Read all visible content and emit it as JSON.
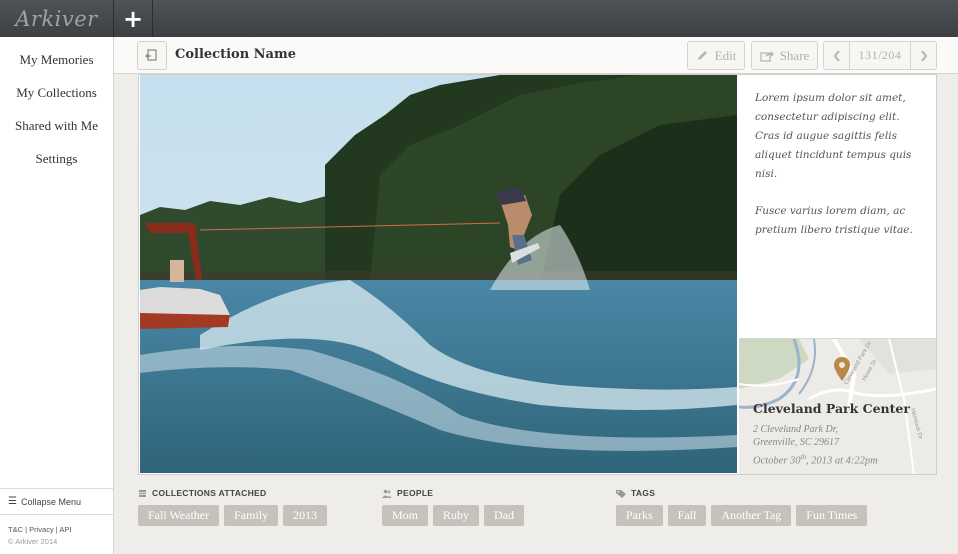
{
  "app": {
    "logo": "Arkiver",
    "add_label": "+"
  },
  "sidebar": {
    "items": [
      {
        "label": "My Memories"
      },
      {
        "label": "My Collections"
      },
      {
        "label": "Shared with Me"
      },
      {
        "label": "Settings"
      }
    ],
    "collapse_label": "Collapse Menu",
    "footer_links": [
      "T&C",
      "Privacy",
      "API"
    ],
    "footer_separator": " | ",
    "copyright": "© Arkiver 2014"
  },
  "header": {
    "collection_name": "Collection Name",
    "edit_label": "Edit",
    "share_label": "Share",
    "pager_text": "131/204"
  },
  "memory": {
    "description": [
      "Lorem ipsum dolor sit amet, consectetur adipiscing elit. Cras id augue sagittis felis aliquet tincidunt tempus quis nisi.",
      "Fusce varius lorem diam, ac pretium libero tristique vitae."
    ],
    "location": {
      "name": "Cleveland Park Center",
      "address_line1": "2 Cleveland Park Dr,",
      "address_line2": "Greenville, SC 29617",
      "date_prefix": "October 30",
      "date_suffix": "th",
      "date_rest": ", 2013 at 4:22pm",
      "map_labels": [
        "Cleveland Park Dr",
        "Howe St",
        "Hemlock Dr"
      ]
    }
  },
  "groups": {
    "collections": {
      "title": "COLLECTIONS ATTACHED",
      "items": [
        "Fall Weather",
        "Family",
        "2013"
      ]
    },
    "people": {
      "title": "PEOPLE",
      "items": [
        "Mom",
        "Ruby",
        "Dad"
      ]
    },
    "tags": {
      "title": "TAGS",
      "items": [
        "Parks",
        "Fall",
        "Another Tag",
        "Fun Times"
      ]
    }
  },
  "colors": {
    "topbar": "#44484b",
    "chip": "#c6c1bb",
    "map_pin": "#b8894a",
    "map_water": "#9cb3c9",
    "map_park": "#cdd9c2"
  },
  "icons": {
    "back": "collection-back-icon",
    "edit": "pencil-icon",
    "share": "share-arrow-icon",
    "prev": "chevron-left-icon",
    "next": "chevron-right-icon",
    "collapse": "hamburger-icon",
    "collections": "stack-icon",
    "people": "people-icon",
    "tags": "tag-icon",
    "map": "map-pin-icon"
  }
}
